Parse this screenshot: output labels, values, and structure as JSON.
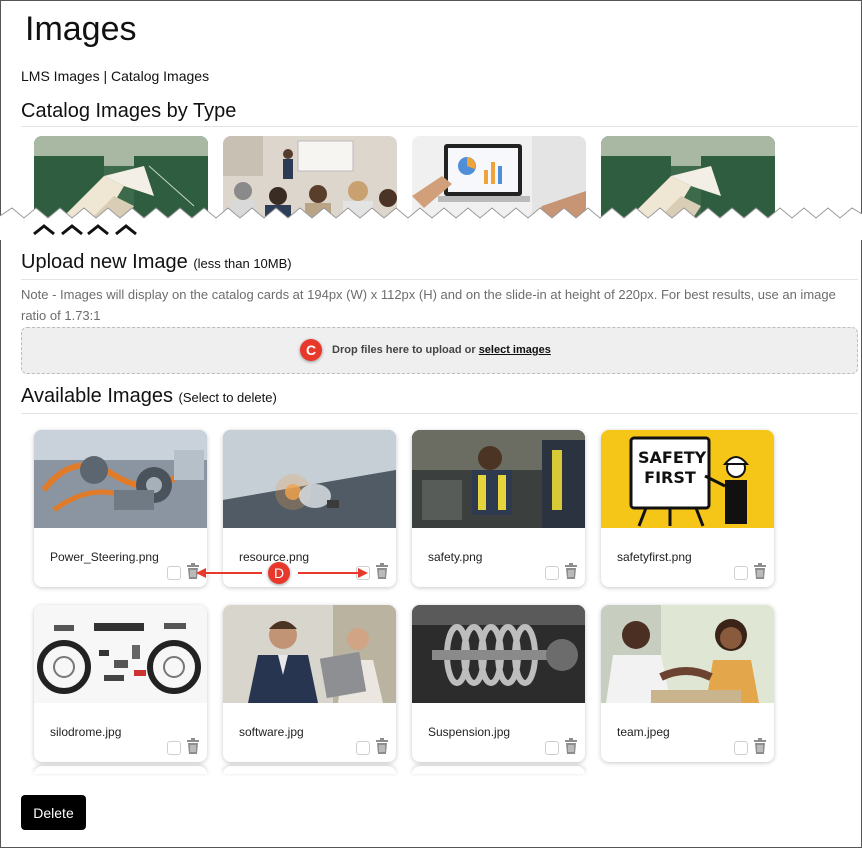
{
  "page": {
    "title": "Images"
  },
  "breadcrumb": {
    "lms": "LMS Images",
    "separator": " | ",
    "catalog": "Catalog Images"
  },
  "catalog": {
    "heading": "Catalog Images by Type"
  },
  "upload": {
    "heading": "Upload new Image",
    "heading_note": "(less than 10MB)",
    "note": "Note - Images will display on the catalog cards at 194px (W) x 112px (H) and on the slide-in at height of 220px. For best results, use an image ratio of 1.73:1",
    "drop_text": "Drop files here to upload or",
    "select_link": "select images",
    "callout": "C"
  },
  "available": {
    "heading": "Available Images",
    "heading_note": "(Select to delete)",
    "callout": "D",
    "images": [
      {
        "name": "Power_Steering.png",
        "icon": "engine-photo"
      },
      {
        "name": "resource.png",
        "icon": "lightbulb-laptop-photo"
      },
      {
        "name": "safety.png",
        "icon": "worker-photo"
      },
      {
        "name": "safetyfirst.png",
        "icon": "safety-first-sign"
      },
      {
        "name": "silodrome.jpg",
        "icon": "motorcycle-parts-photo"
      },
      {
        "name": "software.jpg",
        "icon": "business-people-photo"
      },
      {
        "name": "Suspension.jpg",
        "icon": "coil-spring-photo"
      },
      {
        "name": "team.jpeg",
        "icon": "handshake-photo"
      }
    ]
  },
  "safety_sign": {
    "line1": "SAFETY",
    "line2": "FIRST"
  },
  "actions": {
    "delete_label": "Delete"
  },
  "colors": {
    "accent": "#e8382c",
    "button": "#000000",
    "sign_yellow": "#f5c518"
  }
}
